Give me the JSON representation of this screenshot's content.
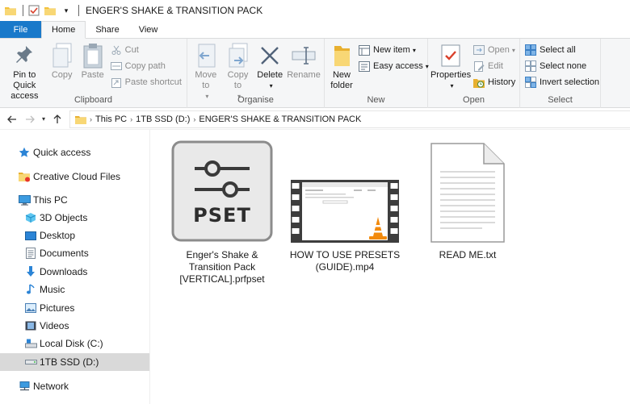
{
  "window": {
    "title": "ENGER'S SHAKE & TRANSITION PACK"
  },
  "tabs": [
    {
      "label": "File"
    },
    {
      "label": "Home"
    },
    {
      "label": "Share"
    },
    {
      "label": "View"
    }
  ],
  "ribbon": {
    "clipboard": {
      "label": "Clipboard",
      "pin": "Pin to Quick access",
      "copy": "Copy",
      "paste": "Paste",
      "cut": "Cut",
      "copy_path": "Copy path",
      "paste_shortcut": "Paste shortcut"
    },
    "organise": {
      "label": "Organise",
      "move_to": "Move to",
      "copy_to": "Copy to",
      "delete": "Delete",
      "rename": "Rename"
    },
    "new": {
      "label": "New",
      "new_folder": "New folder",
      "new_item": "New item",
      "easy_access": "Easy access"
    },
    "open": {
      "label": "Open",
      "properties": "Properties",
      "open": "Open",
      "edit": "Edit",
      "history": "History"
    },
    "select": {
      "label": "Select",
      "select_all": "Select all",
      "select_none": "Select none",
      "invert_selection": "Invert selection"
    }
  },
  "breadcrumb": [
    "This PC",
    "1TB SSD (D:)",
    "ENGER'S SHAKE & TRANSITION PACK"
  ],
  "sidebar": {
    "quick_access": "Quick access",
    "creative_cloud": "Creative Cloud Files",
    "this_pc": "This PC",
    "objects_3d": "3D Objects",
    "desktop": "Desktop",
    "documents": "Documents",
    "downloads": "Downloads",
    "music": "Music",
    "pictures": "Pictures",
    "videos": "Videos",
    "local_disk": "Local Disk (C:)",
    "ssd": "1TB SSD (D:)",
    "network": "Network"
  },
  "files": {
    "preset": {
      "name": "Enger's Shake & Transition Pack [VERTICAL].prfpset",
      "badge": "PSET"
    },
    "video": {
      "name": "HOW TO USE PRESETS (GUIDE).mp4"
    },
    "readme": {
      "name": "READ ME.txt"
    }
  },
  "colors": {
    "file_tab": "#1979ca",
    "ribbon_bg": "#f5f6f7",
    "selected_nav": "#d9d9d9",
    "folder_yellow": "#f3c23c",
    "quick_access_blue": "#2b84d6"
  }
}
